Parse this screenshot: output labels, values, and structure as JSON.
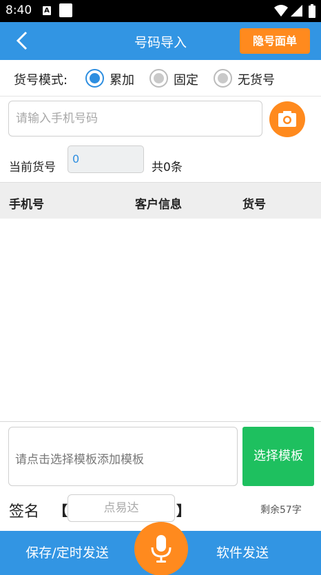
{
  "status_bar": {
    "time": "8:40",
    "a_icon": "A"
  },
  "app_bar": {
    "title": "号码导入",
    "hidden_list_button": "隐号面单"
  },
  "mode": {
    "label": "货号模式:",
    "options": [
      {
        "label": "累加",
        "checked": true
      },
      {
        "label": "固定",
        "checked": false
      },
      {
        "label": "无货号",
        "checked": false
      }
    ]
  },
  "phone_input": {
    "placeholder": "请输入手机号码",
    "value": ""
  },
  "current_number": {
    "label": "当前货号",
    "value": "0",
    "total": "共0条"
  },
  "table": {
    "columns": [
      "手机号",
      "客户信息",
      "货号"
    ],
    "rows": []
  },
  "template": {
    "placeholder": "请点击选择模板添加模板",
    "select_button": "选择模板"
  },
  "signature": {
    "label": "签名",
    "bracket_left": "【",
    "bracket_right": "】",
    "placeholder": "点易达",
    "remaining": "剩余57字"
  },
  "bottom_bar": {
    "save_button": "保存/定时发送",
    "send_button": "软件发送"
  },
  "colors": {
    "primary": "#3295e3",
    "accent": "#ff8a1e",
    "green": "#1ec05f"
  },
  "icons": {
    "back": "chevron-left-icon",
    "camera": "camera-icon",
    "mic": "microphone-icon",
    "wifi": "wifi-icon",
    "signal": "signal-icon",
    "battery": "battery-icon"
  }
}
